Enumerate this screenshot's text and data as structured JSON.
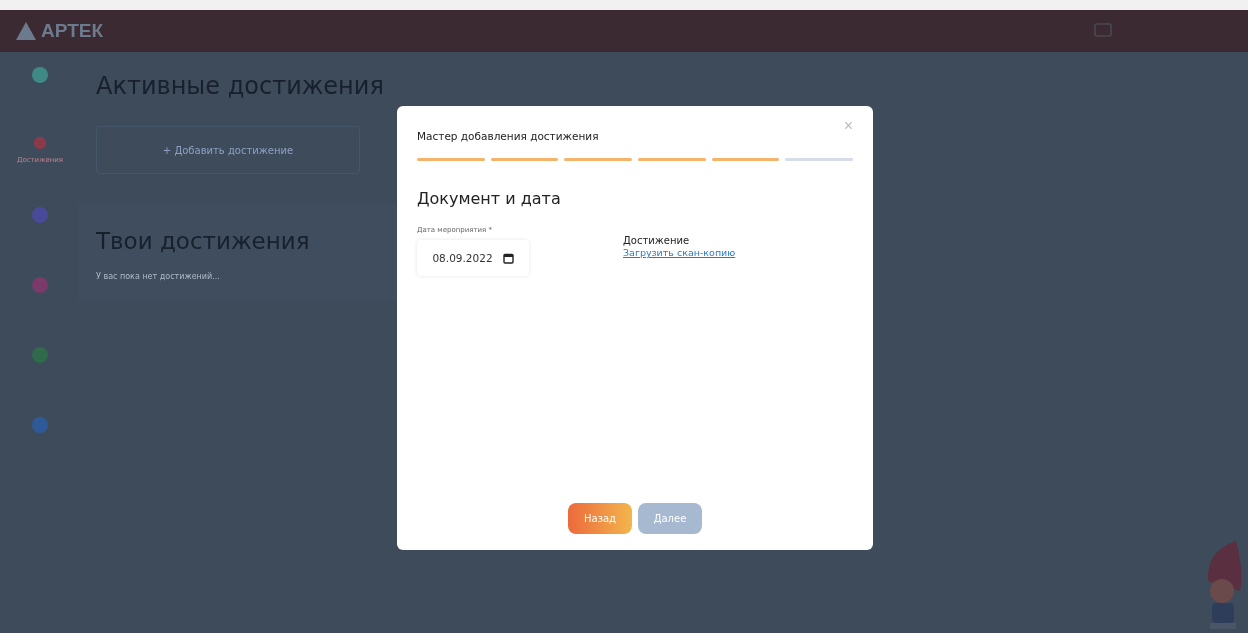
{
  "header": {
    "logo": "АРТЕК"
  },
  "sidebar": {
    "items": [
      {
        "color": "#3f8a86"
      },
      {
        "color": "#8a3a4a",
        "label": "Достижения",
        "selected": true
      },
      {
        "color": "#4a4a9a"
      },
      {
        "color": "#7a3a6a"
      },
      {
        "color": "#2f6a4a"
      },
      {
        "color": "#2f5a9a"
      }
    ]
  },
  "main": {
    "active_title": "Активные достижения",
    "add_button": {
      "icon": "+",
      "label": "Добавить достижение"
    },
    "your_title": "Твои достижения",
    "empty_text": "У вас пока нет достижений..."
  },
  "modal": {
    "title": "Мастер добавления достижения",
    "close": "×",
    "steps": [
      {
        "done": true
      },
      {
        "done": true
      },
      {
        "done": true
      },
      {
        "done": true
      },
      {
        "done": true
      },
      {
        "done": false
      }
    ],
    "heading": "Документ и дата",
    "date_field": {
      "label": "Дата мероприятия *",
      "value": "08.09.2022"
    },
    "document": {
      "label": "Достижение",
      "link": "Загрузить скан-копию"
    },
    "buttons": [
      {
        "label": "Назад",
        "disabled": false
      },
      {
        "label": "Далее",
        "disabled": true
      }
    ]
  }
}
